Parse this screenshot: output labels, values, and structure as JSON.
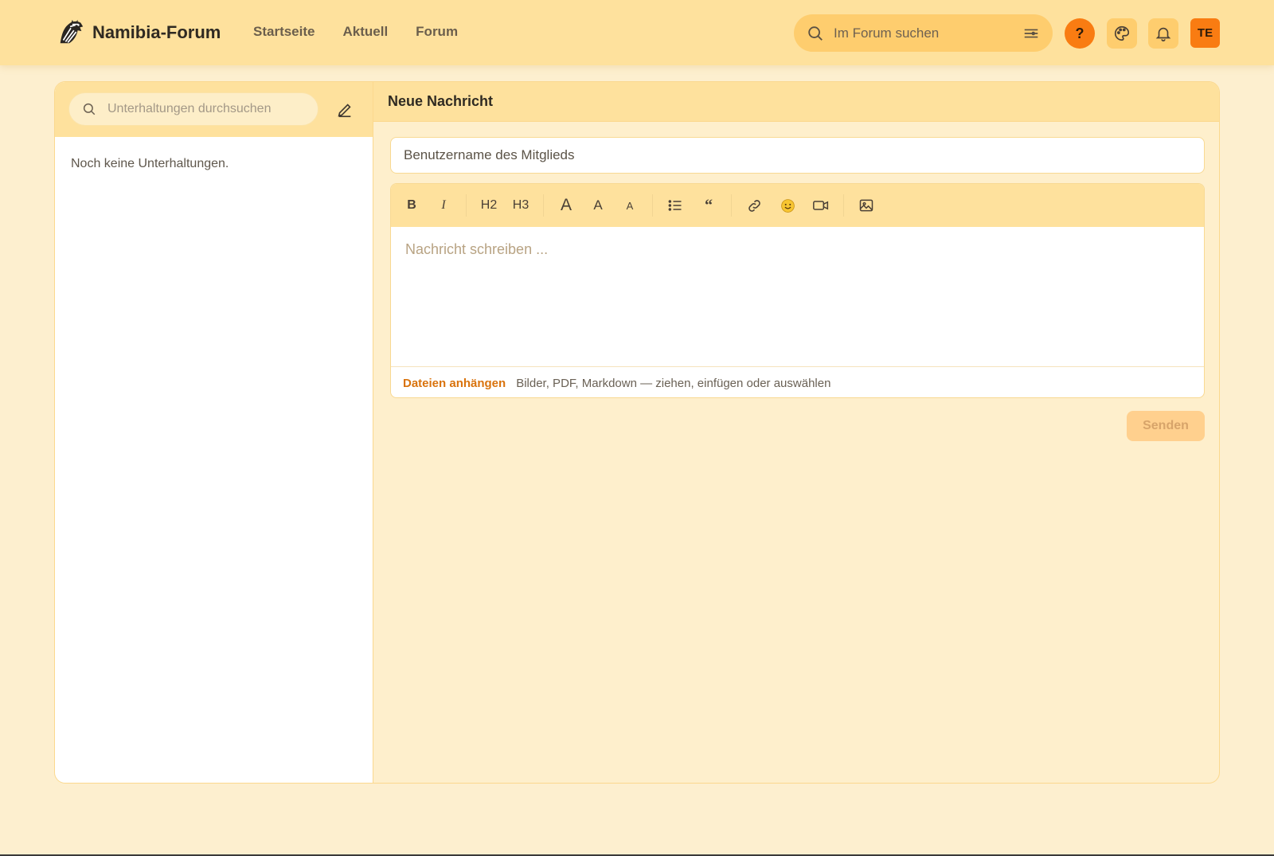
{
  "brand": {
    "name": "Namibia-Forum"
  },
  "nav": [
    "Startseite",
    "Aktuell",
    "Forum"
  ],
  "search": {
    "placeholder": "Im Forum suchen"
  },
  "header": {
    "help_label": "?",
    "avatar_initials": "TE"
  },
  "sidebar": {
    "search_placeholder": "Unterhaltungen durchsuchen",
    "empty_text": "Noch keine Unterhaltungen."
  },
  "message": {
    "title": "Neue Nachricht",
    "recipient_placeholder": "Benutzername des Mitglieds",
    "toolbar": {
      "bold": "B",
      "italic": "I",
      "h2": "H2",
      "h3": "H3",
      "font_large": "A",
      "font_medium": "A",
      "font_small": "A",
      "quote": "“"
    },
    "body_placeholder": "Nachricht schreiben ...",
    "attach_label": "Dateien anhängen",
    "attach_hint": "Bilder, PDF, Markdown — ziehen, einfügen oder auswählen",
    "send_label": "Senden"
  },
  "colors": {
    "accent": "#f97c12",
    "header_bg": "#fee19d",
    "page_bg": "#fdefcf",
    "link": "#d9730d"
  }
}
